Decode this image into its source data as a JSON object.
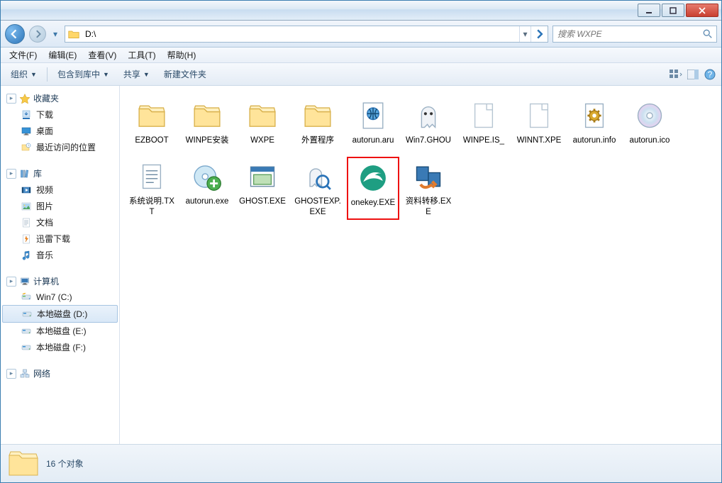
{
  "window": {
    "title": ""
  },
  "nav": {
    "path": "D:\\"
  },
  "search": {
    "placeholder": "搜索 WXPE"
  },
  "menu": [
    "文件(F)",
    "编辑(E)",
    "查看(V)",
    "工具(T)",
    "帮助(H)"
  ],
  "toolbar": {
    "organize": "组织",
    "includeLib": "包含到库中",
    "share": "共享",
    "newFolder": "新建文件夹"
  },
  "sidebar": {
    "groups": [
      {
        "head": "收藏夹",
        "icon": "star",
        "items": [
          {
            "label": "下载",
            "icon": "download"
          },
          {
            "label": "桌面",
            "icon": "desktop"
          },
          {
            "label": "最近访问的位置",
            "icon": "recent"
          }
        ]
      },
      {
        "head": "库",
        "icon": "library",
        "items": [
          {
            "label": "视频",
            "icon": "video"
          },
          {
            "label": "图片",
            "icon": "picture"
          },
          {
            "label": "文档",
            "icon": "doc"
          },
          {
            "label": "迅雷下载",
            "icon": "xunlei"
          },
          {
            "label": "音乐",
            "icon": "music"
          }
        ]
      },
      {
        "head": "计算机",
        "icon": "computer",
        "items": [
          {
            "label": "Win7 (C:)",
            "icon": "drive-c"
          },
          {
            "label": "本地磁盘 (D:)",
            "icon": "drive",
            "selected": true
          },
          {
            "label": "本地磁盘 (E:)",
            "icon": "drive"
          },
          {
            "label": "本地磁盘 (F:)",
            "icon": "drive"
          }
        ]
      },
      {
        "head": "网络",
        "icon": "network",
        "items": []
      }
    ]
  },
  "files": [
    {
      "name": "EZBOOT",
      "icon": "folder"
    },
    {
      "name": "WINPE安装",
      "icon": "folder"
    },
    {
      "name": "WXPE",
      "icon": "folder"
    },
    {
      "name": "外置程序",
      "icon": "folder"
    },
    {
      "name": "autorun.aru",
      "icon": "globe-doc"
    },
    {
      "name": "Win7.GHOU",
      "icon": "ghost"
    },
    {
      "name": "WINPE.IS_",
      "icon": "blank"
    },
    {
      "name": "WINNT.XPE",
      "icon": "blank"
    },
    {
      "name": "autorun.info",
      "icon": "gear-doc"
    },
    {
      "name": "autorun.ico",
      "icon": "disc"
    },
    {
      "name": "系统说明.TXT",
      "icon": "text-doc"
    },
    {
      "name": "autorun.exe",
      "icon": "cd-green"
    },
    {
      "name": "GHOST.EXE",
      "icon": "app-win"
    },
    {
      "name": "GHOSTEXP.EXE",
      "icon": "ghost-mag"
    },
    {
      "name": "onekey.EXE",
      "icon": "onekey",
      "highlight": true
    },
    {
      "name": "资料转移.EXE",
      "icon": "migrate"
    }
  ],
  "status": {
    "count": "16 个对象"
  }
}
